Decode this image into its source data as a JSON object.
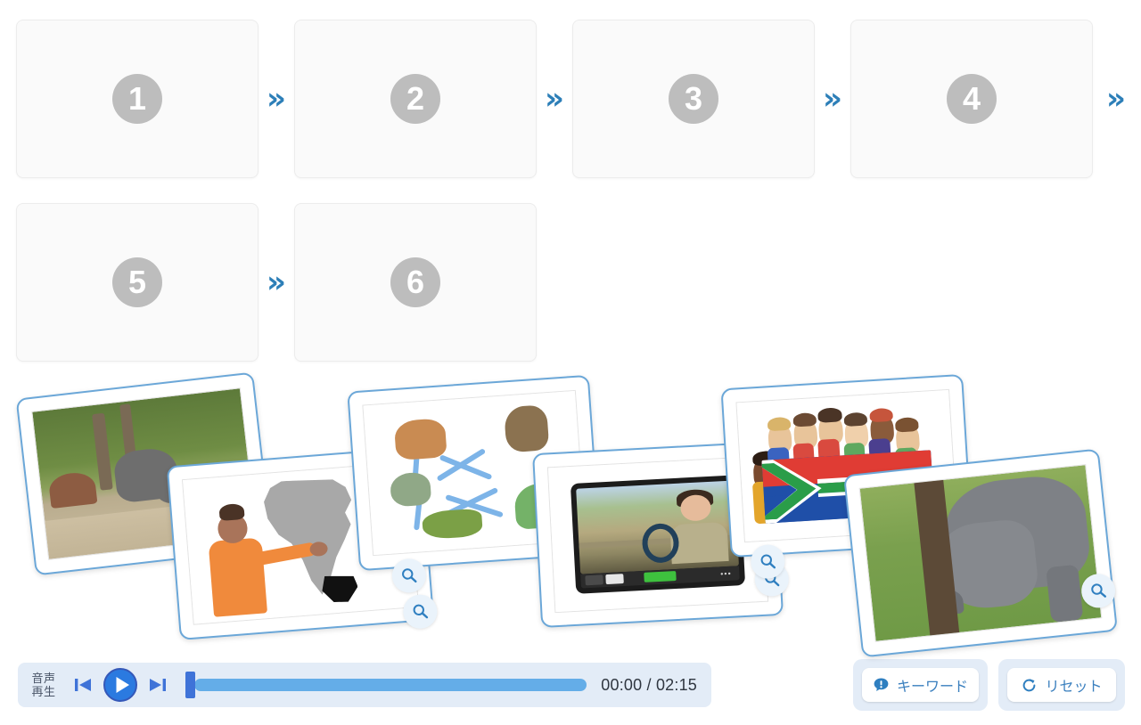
{
  "sequence": {
    "slots": [
      {
        "number": "1",
        "placeholder_label": "drop-slot-1"
      },
      {
        "number": "2",
        "placeholder_label": "drop-slot-2"
      },
      {
        "number": "3",
        "placeholder_label": "drop-slot-3"
      },
      {
        "number": "4",
        "placeholder_label": "drop-slot-4"
      },
      {
        "number": "5",
        "placeholder_label": "drop-slot-5"
      },
      {
        "number": "6",
        "placeholder_label": "drop-slot-6"
      }
    ],
    "separator_glyph": "»",
    "separator_color": "#2d7fb8",
    "badge_color": "#bdbdbd",
    "slot_background": "#fafafa"
  },
  "cards": [
    {
      "id": "card-wildebeest-river",
      "scene": "river",
      "alt": "wildebeest crossing a river",
      "zoom_icon": "magnifier-icon",
      "has_zoom": false
    },
    {
      "id": "card-africa-map",
      "scene": "map",
      "alt": "presenter pointing at map of Africa with South Africa highlighted",
      "zoom_icon": "magnifier-icon",
      "has_zoom": true
    },
    {
      "id": "card-food-web",
      "scene": "web",
      "alt": "food web diagram with fox, hawk, bird, grasshopper and bush",
      "zoom_icon": "magnifier-icon",
      "has_zoom": false
    },
    {
      "id": "card-video-call",
      "scene": "call",
      "alt": "video call with a safari ranger driving a vehicle",
      "zoom_icon": "magnifier-icon",
      "has_zoom": true
    },
    {
      "id": "card-children-flag",
      "scene": "flag",
      "alt": "children holding the South African flag",
      "zoom_icon": "magnifier-icon",
      "has_zoom": false
    },
    {
      "id": "card-rhino",
      "scene": "rhino",
      "alt": "rhinoceros rubbing against a tree",
      "zoom_icon": "magnifier-icon",
      "has_zoom": true
    }
  ],
  "player": {
    "label_line1": "音声",
    "label_line2": "再生",
    "prev_icon": "skip-previous-icon",
    "play_icon": "play-icon",
    "next_icon": "skip-next-icon",
    "current_time": "00:00",
    "total_time": "02:15",
    "timecode": "00:00 / 02:15",
    "progress_percent": 0,
    "accent_color": "#64ade8",
    "handle_color": "#3f73d8",
    "panel_color": "#e3ecf7"
  },
  "actions": {
    "keyword": {
      "label": "キーワード",
      "icon": "alert-bubble-icon"
    },
    "reset": {
      "label": "リセット",
      "icon": "refresh-icon"
    },
    "text_color": "#3a7fbe"
  }
}
